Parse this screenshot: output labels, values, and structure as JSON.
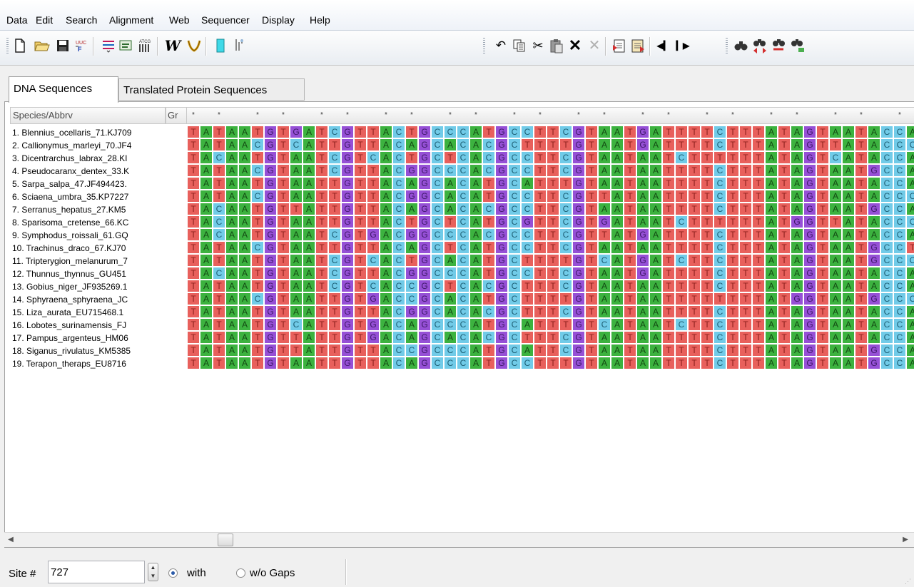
{
  "menu": [
    "Data",
    "Edit",
    "Search",
    "Alignment",
    "Web",
    "Sequencer",
    "Display",
    "Help"
  ],
  "toolbar": {
    "new_icon": "new-file-icon",
    "open_icon": "open-folder-icon",
    "save_icon": "save-disk-icon",
    "w_label": "W"
  },
  "tabs": [
    "DNA Sequences",
    "Translated Protein Sequences"
  ],
  "table": {
    "name_header": "Species/Abbrv",
    "group_header": "Gr",
    "conservation": "*.*..*.*..*.*..*.*..*.*..*.*..*.*..*.*..*.*..*.*..*.*..*.*..*.*..*.*..*.*..*.*..*****.*.*..*.*..*.*.",
    "rows": [
      {
        "name": "1. Blennius_ocellaris_71.KJ709",
        "seq": "TATAATGTGATCGTTACTGCCCATGCCTTCGTAATGATTTTCTTTATAGTAATACCA"
      },
      {
        "name": "2. Callionymus_marleyi_70.JF4",
        "seq": "TATAACGTCATTGTTACAGCACACGCTTTTGTAATGATTTTCTTTATAGTTATACCC"
      },
      {
        "name": "3. Dicentrarchus_labrax_28.KI",
        "seq": "TACAATGTAATCGTCACTGCTCACGCCTTCGTAATAATCTTTTTTATAGTCATACCA"
      },
      {
        "name": "4. Pseudocaranx_dentex_33.K",
        "seq": "TATAACGTAATCGTTACGGCCCACGCCTTCGTAATAATTTTCTTTATAGTAATGCCA"
      },
      {
        "name": "5. Sarpa_salpa_47.JF494423.",
        "seq": "TATAATGTAATTGTTACAGCACATGCATTTGTAATAATTTTCTTTATAGTAATACCA"
      },
      {
        "name": "6. Sciaena_umbra_35.KP7227",
        "seq": "TATAACGTAATTGTTACGGCACATGCCTTCGTTATAATTTTCTTTATAGTAATACCC"
      },
      {
        "name": "7. Serranus_hepatus_27.KM5",
        "seq": "TACAATGTTATTGTTACAGCACACGCCTTCGTAATAATTTTCTTTATAGTAATGCCA"
      },
      {
        "name": "8. Sparisoma_cretense_66.KC",
        "seq": "TACAATGTAATTGTTACTGCTCATGCGTTCGTGATAATCTTTTTTATGGTTATACCC"
      },
      {
        "name": "9. Symphodus_roissali_61.GQ",
        "seq": "TACAATGTAATCGTGACGGCCCACGCCTTCGTTATGATTTTCTTTATAGTAATACCA"
      },
      {
        "name": "10. Trachinus_draco_67.KJ70",
        "seq": "TATAACGTAATTGTTACAGCTCATGCCTTCGTAATAATTTTCTTTATAGTAATGCCT"
      },
      {
        "name": "11. Tripterygion_melanurum_7",
        "seq": "TATAATGTAATCGTCACTGCACATGCTTTTGTCATGATCTTCTTTATAGTAATGCCC"
      },
      {
        "name": "12. Thunnus_thynnus_GU451",
        "seq": "TACAATGTAATCGTTACGGCCCATGCCTTCGTAATGATTTTCTTTATAGTAATACCA"
      },
      {
        "name": "13. Gobius_niger_JF935269.1",
        "seq": "TATAATGTAATCGTCACCGCTCACGCTTTCGTAATAATTTTCTTTATAGTAATACCA"
      },
      {
        "name": "14. Sphyraena_sphyraena_JC",
        "seq": "TATAACGTAATTGTGACCGCACATGCTTTTGTAATAATTTTTTTTATGGTAATGCCC"
      },
      {
        "name": "15. Liza_aurata_EU715468.1",
        "seq": "TATAATGTAATTGTTACGGCACACGCTTTCGTAATAATTTTCTTTATAGTAATACCA"
      },
      {
        "name": "16. Lobotes_surinamensis_FJ",
        "seq": "TATAATGTCATTGTGACAGCCCATGCATTTGTCATAATCTTCTTTATAGTAATACCA"
      },
      {
        "name": "17. Pampus_argenteus_HM06",
        "seq": "TATAATGTTATTGTGACAGCACACGCTTTCGTAATAATTTTCTTTATAGTAATACCA"
      },
      {
        "name": "18. Siganus_rivulatus_KM5385",
        "seq": "TATAATGTTATTGTTACCGCCCATGCATTCGTAATAATTTTCTTTATAGTAATGCCA"
      },
      {
        "name": "19. Terapon_theraps_EU8716",
        "seq": "TATAATGTAATTGTTACAGCCCATGCCTTTGTAATAATTTTCTTTATAGTAATGCCA"
      }
    ]
  },
  "nucleotide_colors": {
    "T": "#e8605c",
    "A": "#3cb23f",
    "C": "#71cbe8",
    "G": "#9650d6"
  },
  "status": {
    "site_label": "Site #",
    "site_value": "727",
    "with_label": "with",
    "without_label": "w/o Gaps",
    "selected": "with"
  }
}
